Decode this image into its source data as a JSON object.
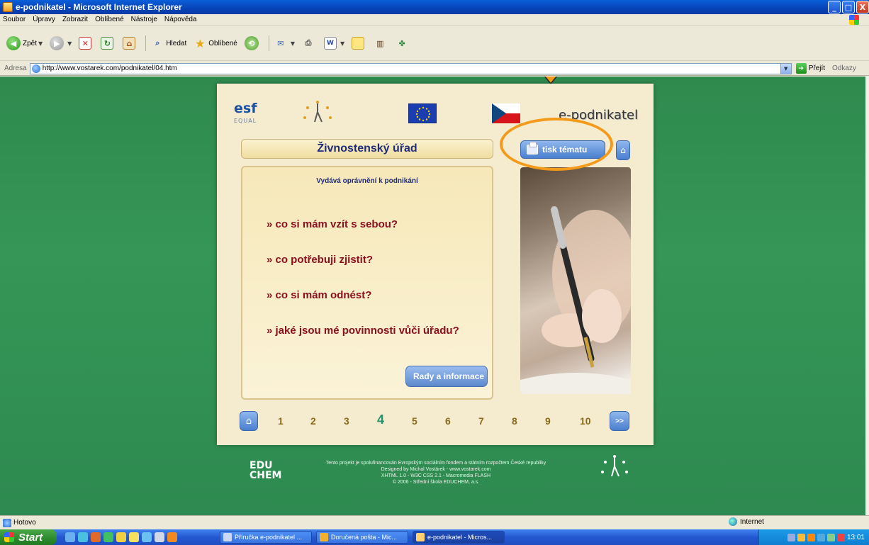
{
  "window": {
    "title": "e-podnikatel - Microsoft Internet Explorer",
    "buttons": [
      "_",
      "□",
      "X"
    ]
  },
  "menu": {
    "items": [
      "Soubor",
      "Úpravy",
      "Zobrazit",
      "Oblíbené",
      "Nástroje",
      "Nápověda"
    ]
  },
  "toolbar": {
    "back_label": "Zpět",
    "search_label": "Hledat",
    "favorites_label": "Oblíbené"
  },
  "address": {
    "label": "Adresa",
    "url": "http://www.vostarek.com/podnikatel/04.htm",
    "go_label": "Přejít",
    "links_label": "Odkazy"
  },
  "page": {
    "brand": "e-podnikatel",
    "esf_top": "esf",
    "esf_bottom": "EQUAL",
    "section_title": "Živnostenský úřad",
    "print_label": "tisk tématu",
    "panel_subtitle": "Vydává oprávnění k podnikání",
    "questions": [
      "» co si mám vzít s sebou?",
      "» co potřebuji zjistit?",
      "» co si mám odnést?",
      "» jaké jsou mé povinnosti vůči úřadu?"
    ],
    "rady_label": "Rady a informace",
    "pager": {
      "pages": [
        "1",
        "2",
        "3",
        "4",
        "5",
        "6",
        "7",
        "8",
        "9",
        "10"
      ],
      "current": "4",
      "next_label": ">>"
    },
    "footer": {
      "logo_line1": "EDU",
      "logo_line2": "CHEM",
      "lines": [
        "Tento projekt je spolufinancován Evropským sociálním fondem a státním rozpočtem České republiky",
        "Designed by Michal Vostárek - www.vostarek.com",
        "XHTML 1.0 - W3C CSS 2.1 - Macromedia FLASH",
        "© 2006 - Střední škola EDUCHEM, a.s."
      ]
    }
  },
  "annotation": {
    "color": "#f39a1a"
  },
  "status": {
    "text": "Hotovo",
    "zone": "Internet"
  },
  "taskbar": {
    "start_label": "Start",
    "tasks": [
      "Příručka e-podnikatel ...",
      "Doručená pošta - Mic...",
      "e-podnikatel - Micros..."
    ],
    "clock": "13:01"
  }
}
